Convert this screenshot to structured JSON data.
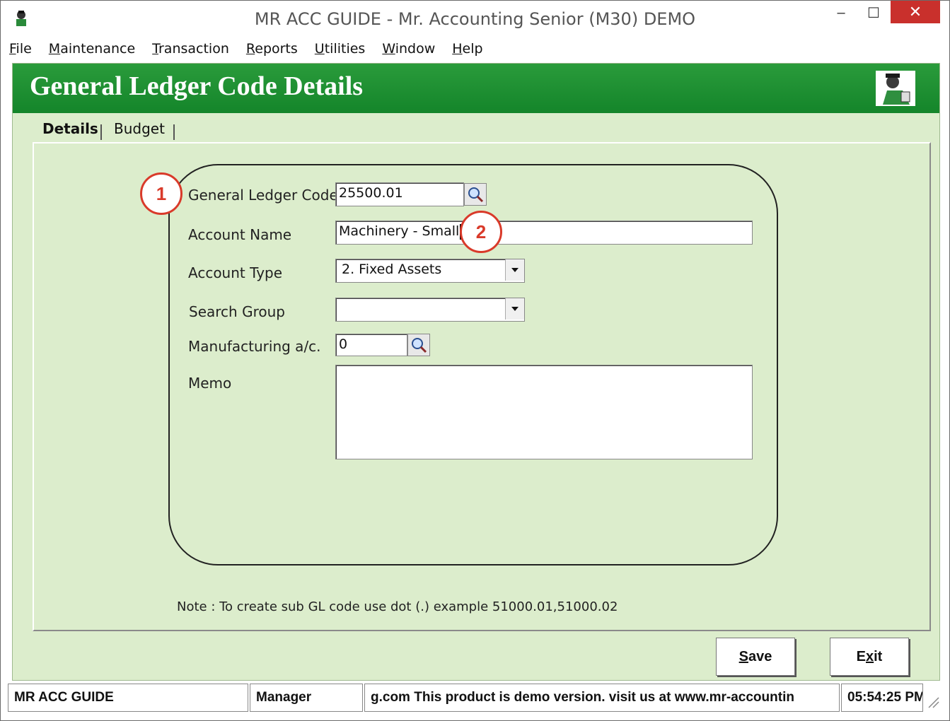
{
  "window": {
    "title": "MR ACC GUIDE - Mr. Accounting Senior (M30) DEMO",
    "minimize": "–",
    "maximize": "☐",
    "close": "✕"
  },
  "menu": [
    {
      "label": "File",
      "accel": "F",
      "rest": "ile"
    },
    {
      "label": "Maintenance",
      "accel": "M",
      "rest": "aintenance"
    },
    {
      "label": "Transaction",
      "accel": "T",
      "rest": "ransaction"
    },
    {
      "label": "Reports",
      "accel": "R",
      "rest": "eports"
    },
    {
      "label": "Utilities",
      "accel": "U",
      "rest": "tilities"
    },
    {
      "label": "Window",
      "accel": "W",
      "rest": "indow"
    },
    {
      "label": "Help",
      "accel": "H",
      "rest": "elp"
    }
  ],
  "header": {
    "title": "General Ledger Code Details"
  },
  "tabs": [
    {
      "label": "Details",
      "active": true
    },
    {
      "label": "Budget",
      "active": false
    }
  ],
  "form": {
    "gl_code": {
      "label": "General Ledger Code",
      "value": "25500.01"
    },
    "account_name": {
      "label": "Account Name",
      "value": "Machinery - Small"
    },
    "account_type": {
      "label": "Account Type",
      "value": "2. Fixed Assets"
    },
    "search_group": {
      "label": "Search Group",
      "value": ""
    },
    "manufacturing": {
      "label": "Manufacturing a/c.",
      "value": "0"
    },
    "memo": {
      "label": "Memo",
      "value": ""
    }
  },
  "callouts": [
    "1",
    "2"
  ],
  "note": "Note : To create sub GL code use dot (.) example 51000.01,51000.02",
  "buttons": {
    "save": {
      "accel": "S",
      "rest": "ave"
    },
    "exit": {
      "pre": "E",
      "accel": "x",
      "rest": "it"
    }
  },
  "status": {
    "app": "MR ACC GUIDE",
    "user": "Manager",
    "message": "g.com This product is demo version.  visit us at www.mr-accountin",
    "time": "05:54:25 PM"
  },
  "colors": {
    "header_green": "#1d8f30",
    "panel_bg": "#dcedcc",
    "callout_red": "#d93a2a",
    "close_red": "#c9302c"
  }
}
